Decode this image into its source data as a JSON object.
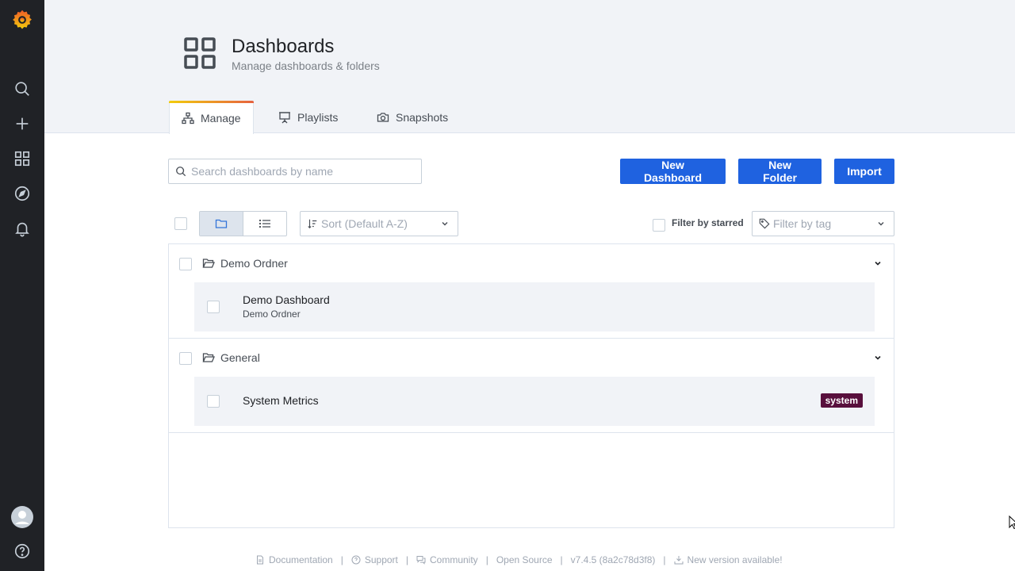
{
  "sidebar": {
    "logo": "grafana-logo-icon",
    "items": [
      {
        "name": "search-icon"
      },
      {
        "name": "plus-icon"
      },
      {
        "name": "dashboards-icon"
      },
      {
        "name": "compass-icon"
      },
      {
        "name": "bell-icon"
      }
    ],
    "bottom": [
      {
        "name": "avatar-icon"
      },
      {
        "name": "help-icon"
      }
    ]
  },
  "header": {
    "title": "Dashboards",
    "subtitle": "Manage dashboards & folders",
    "tabs": [
      {
        "label": "Manage",
        "icon": "sitemap-icon",
        "active": true
      },
      {
        "label": "Playlists",
        "icon": "presentation-icon",
        "active": false
      },
      {
        "label": "Snapshots",
        "icon": "camera-icon",
        "active": false
      }
    ]
  },
  "toolbar": {
    "search_placeholder": "Search dashboards by name",
    "search_value": "",
    "new_dashboard_label": "New Dashboard",
    "new_folder_label": "New Folder",
    "import_label": "Import",
    "sort_label": "Sort (Default A-Z)",
    "filter_starred_label": "Filter by starred",
    "filter_tag_placeholder": "Filter by tag"
  },
  "folders": [
    {
      "name": "Demo Ordner",
      "dashboards": [
        {
          "title": "Demo Dashboard",
          "folder": "Demo Ordner",
          "tags": []
        }
      ]
    },
    {
      "name": "General",
      "dashboards": [
        {
          "title": "System Metrics",
          "folder": "",
          "tags": [
            "system"
          ]
        }
      ]
    }
  ],
  "footer": {
    "documentation": "Documentation",
    "support": "Support",
    "community": "Community",
    "open_source": "Open Source",
    "version": "v7.4.5 (8a2c78d3f8)",
    "new_version": "New version available!",
    "separator": "|"
  },
  "colors": {
    "primary_button": "#1f62e0",
    "sidebar_bg": "#202226",
    "header_bg": "#f1f3f7",
    "tag_system": "#580f3c"
  }
}
